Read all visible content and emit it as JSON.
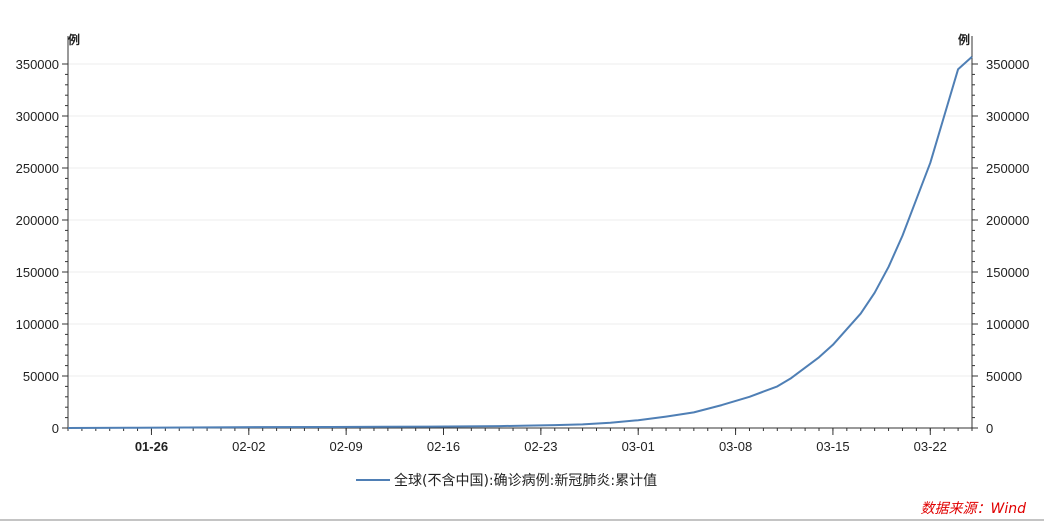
{
  "chart_data": {
    "type": "line",
    "y_unit_left": "例",
    "y_unit_right": "例",
    "ylim": [
      0,
      350000
    ],
    "y_ticks": [
      0,
      50000,
      100000,
      150000,
      200000,
      250000,
      300000,
      350000
    ],
    "y_tick_labels": [
      "0",
      "50000",
      "100000",
      "150000",
      "200000",
      "250000",
      "300000",
      "350000"
    ],
    "x_start": "01-20",
    "x_end": "03-25",
    "x_tick_dates": [
      "01-26",
      "02-02",
      "02-09",
      "02-16",
      "02-23",
      "03-01",
      "03-08",
      "03-15",
      "03-22"
    ],
    "x_tick_labels": [
      "01-26",
      "02-02",
      "02-09",
      "02-16",
      "02-23",
      "03-01",
      "03-08",
      "03-15",
      "03-22"
    ],
    "grid": true,
    "legend_position": "bottom",
    "series": [
      {
        "name": "全球(不含中国):确诊病例:新冠肺炎:累计值",
        "color": "#4f7fb5",
        "x": [
          "01-20",
          "01-25",
          "02-01",
          "02-08",
          "02-15",
          "02-20",
          "02-22",
          "02-24",
          "02-26",
          "02-28",
          "03-01",
          "03-03",
          "03-05",
          "03-07",
          "03-09",
          "03-10",
          "03-11",
          "03-12",
          "03-13",
          "03-14",
          "03-15",
          "03-16",
          "03-17",
          "03-18",
          "03-19",
          "03-20",
          "03-21",
          "03-22",
          "03-23",
          "03-24",
          "03-25"
        ],
        "values": [
          10,
          300,
          800,
          1000,
          1300,
          1800,
          2300,
          2800,
          3500,
          5000,
          7500,
          11000,
          15000,
          22000,
          30000,
          35000,
          40000,
          48000,
          58000,
          68000,
          80000,
          95000,
          110000,
          130000,
          155000,
          185000,
          220000,
          255000,
          300000,
          345000,
          357000
        ]
      }
    ]
  },
  "source": {
    "text": "数据来源：Wind"
  }
}
